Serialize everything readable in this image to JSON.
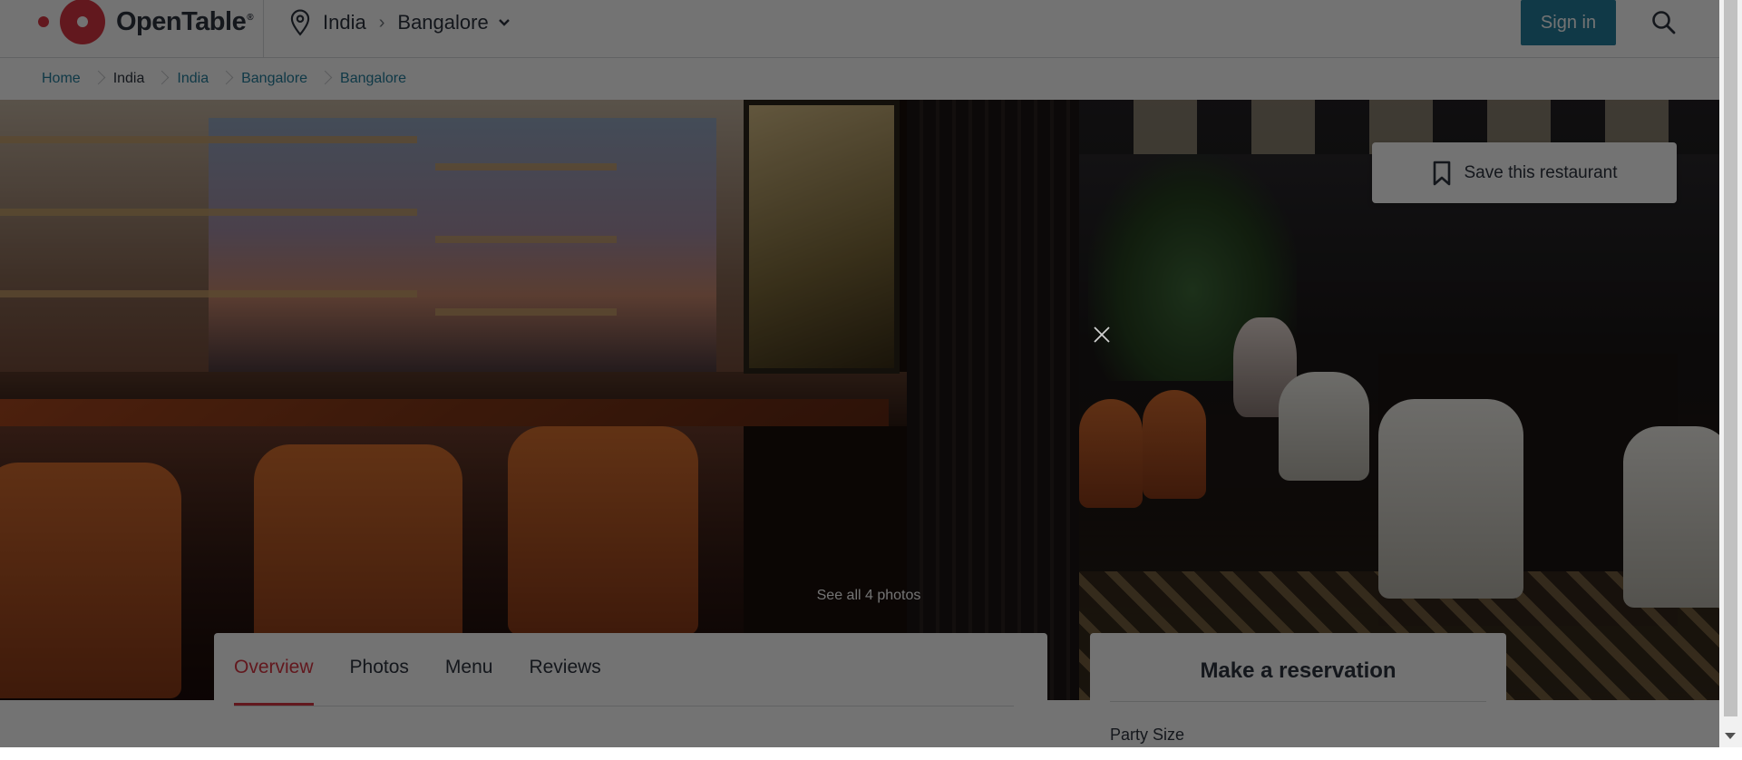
{
  "header": {
    "brand": "OpenTable",
    "brand_mark": "®",
    "location": {
      "country": "India",
      "city": "Bangalore"
    },
    "sign_in_label": "Sign in",
    "icons": {
      "location": "map-pin-icon",
      "dropdown": "chevron-down-icon",
      "search": "search-icon"
    }
  },
  "breadcrumb": [
    {
      "label": "Home",
      "link": true
    },
    {
      "label": "India",
      "link": false
    },
    {
      "label": "India",
      "link": true
    },
    {
      "label": "Bangalore",
      "link": true
    },
    {
      "label": "Bangalore",
      "link": true
    }
  ],
  "hero": {
    "save_label": "Save this restaurant",
    "see_all_photos": "See all 4 photos",
    "icons": {
      "save": "bookmark-icon",
      "close": "close-icon"
    }
  },
  "tabs": [
    {
      "label": "Overview",
      "active": true
    },
    {
      "label": "Photos",
      "active": false
    },
    {
      "label": "Menu",
      "active": false
    },
    {
      "label": "Reviews",
      "active": false
    }
  ],
  "reservation": {
    "title": "Make a reservation",
    "party_size_label": "Party Size"
  },
  "colors": {
    "brand_red": "#da3743",
    "link_teal": "#247f9e",
    "text": "#2d333f"
  }
}
